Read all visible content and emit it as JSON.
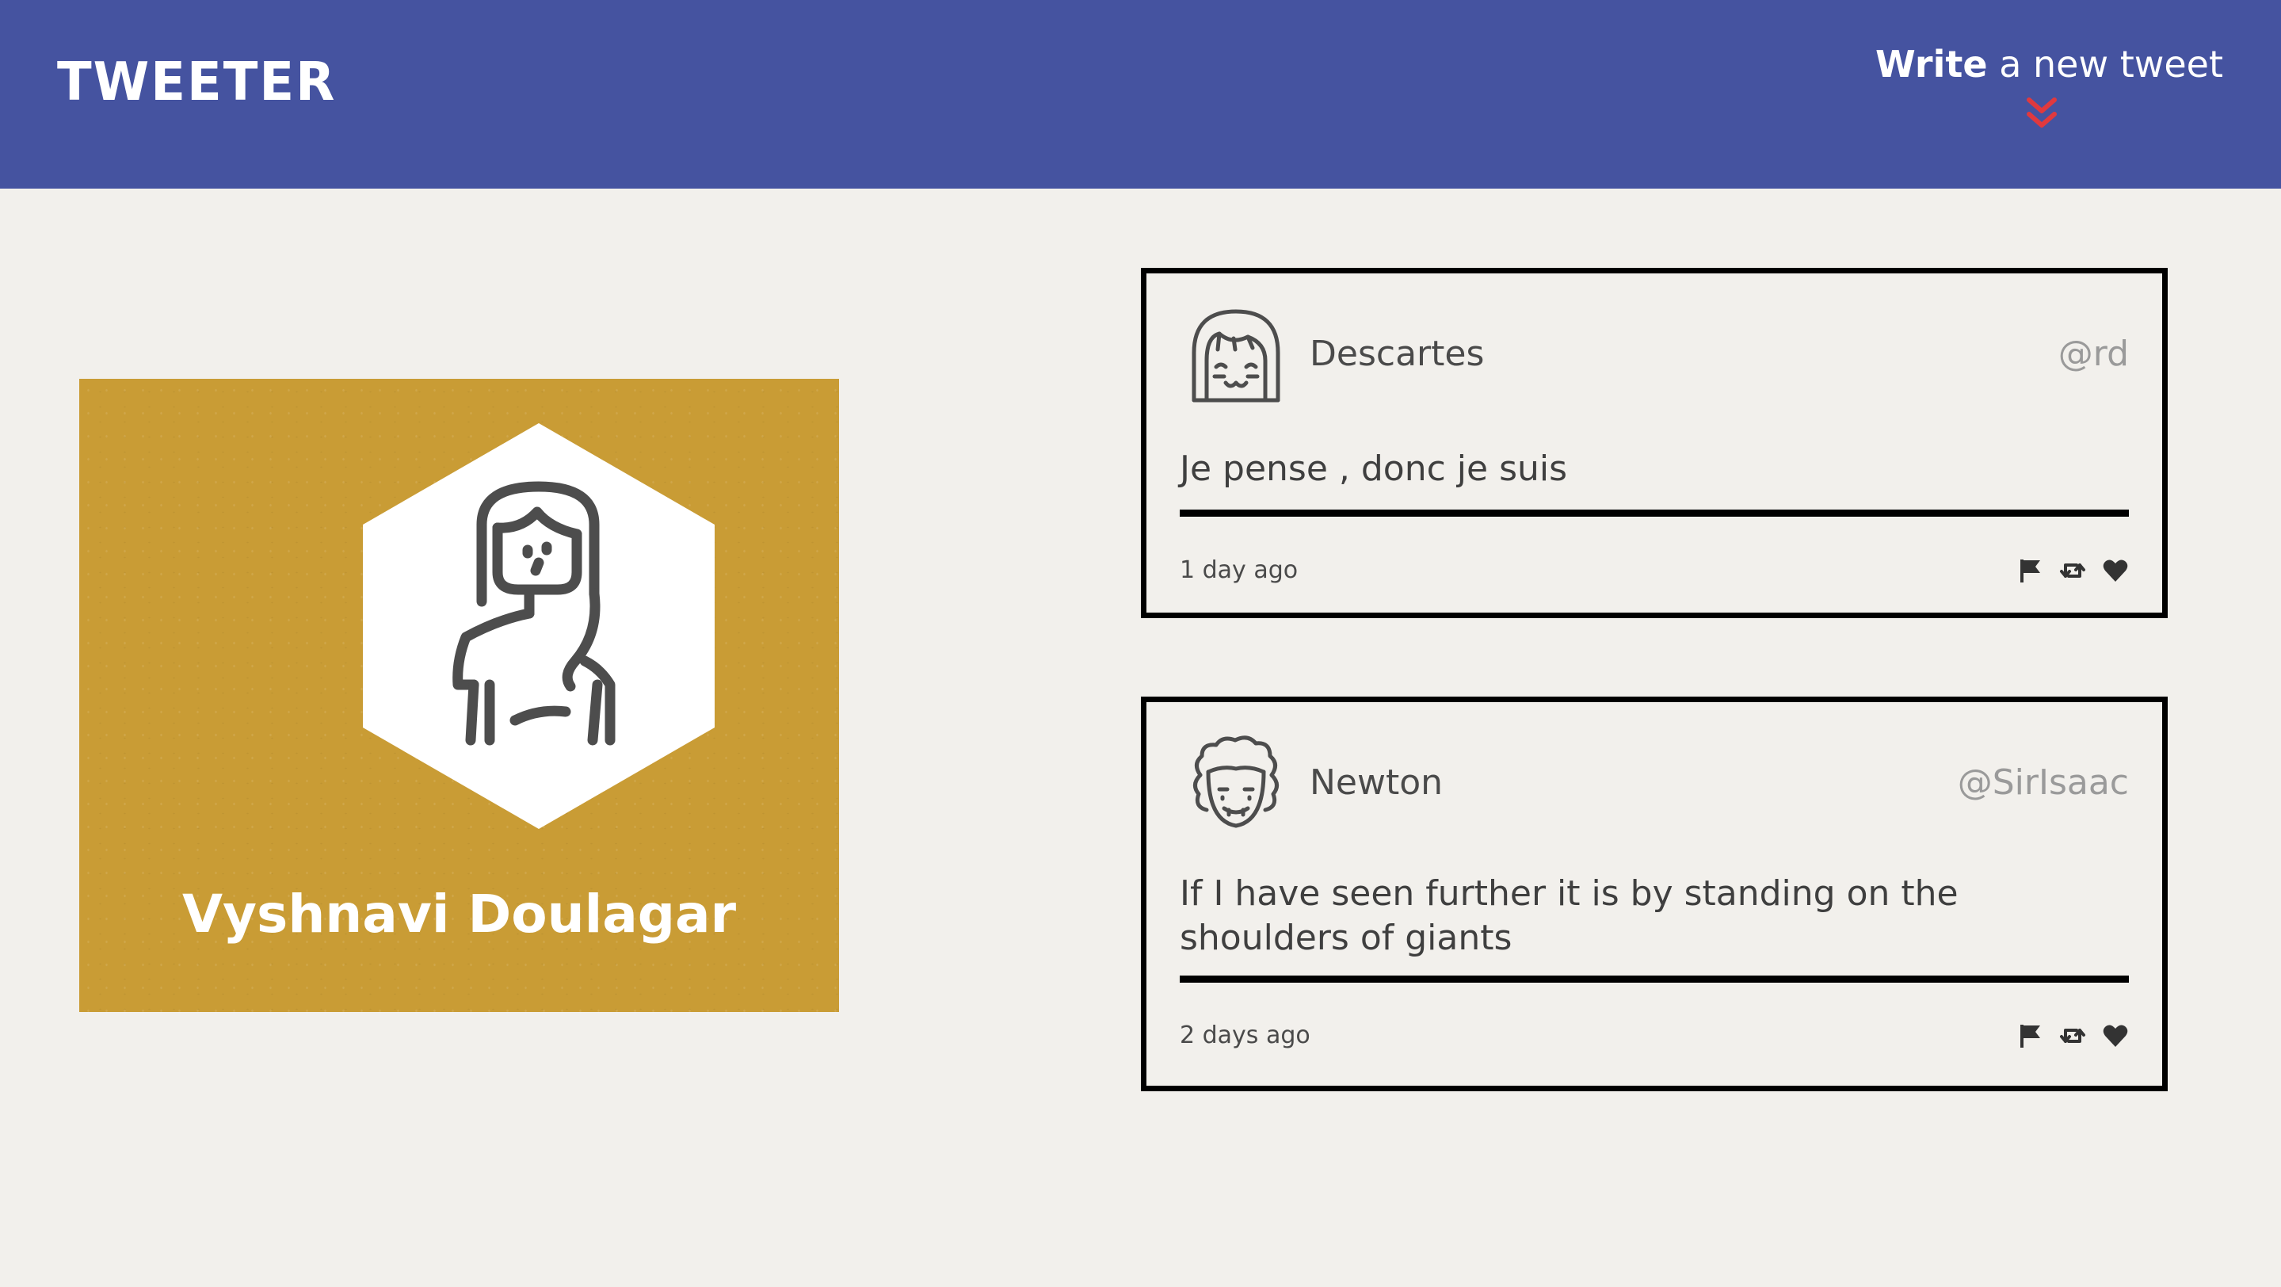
{
  "nav": {
    "brand": "TWEETER",
    "compose_label_bold": "Write",
    "compose_label_rest": " a new tweet",
    "compose_icon": "double-chevron-down-icon",
    "background_color": "#4553a0",
    "accent_color": "#e0393e"
  },
  "profile": {
    "name": "Vyshnavi Doulagar",
    "avatar_icon": "woman-avatar-icon",
    "background_color": "#c99c35"
  },
  "tweets": [
    {
      "author": "Descartes",
      "handle": "@rd",
      "avatar_icon": "smiling-face-avatar-icon",
      "text": "Je pense , donc je suis",
      "time": "1 day ago",
      "actions": [
        "flag-icon",
        "retweet-icon",
        "heart-icon"
      ]
    },
    {
      "author": "Newton",
      "handle": "@SirIsaac",
      "avatar_icon": "curly-hair-avatar-icon",
      "text": "If I have seen further it is by standing on the shoulders of giants",
      "time": "2 days ago",
      "actions": [
        "flag-icon",
        "retweet-icon",
        "heart-icon"
      ]
    }
  ]
}
